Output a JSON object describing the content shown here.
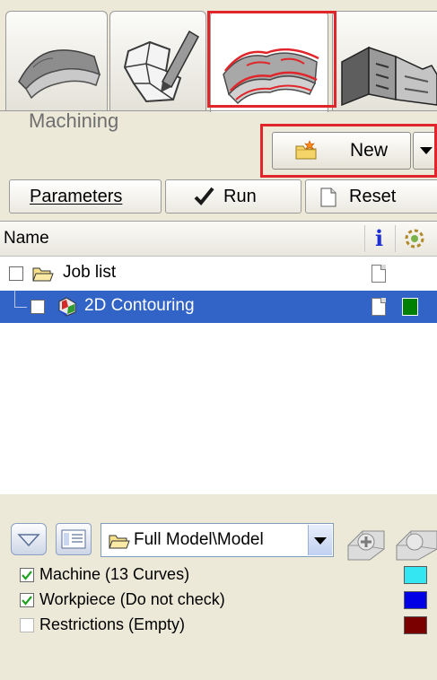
{
  "colors": {
    "selection": "#3164c6",
    "highlight_frame": "#e0262a",
    "machine_swatch": "#33e6f2",
    "workpiece_swatch": "#0000e6",
    "restrictions_swatch": "#7a0000",
    "status_green": "#008000"
  },
  "tabs": [
    {
      "icon": "roof-surface-icon",
      "active": false
    },
    {
      "icon": "sketch-pen-icon",
      "active": false
    },
    {
      "icon": "machining-surface-icon",
      "active": true
    },
    {
      "icon": "factory-icon",
      "active": false
    }
  ],
  "section": {
    "title": "Machining"
  },
  "new_button": {
    "label": "New",
    "icon": "new-folder-icon"
  },
  "actions": {
    "parameters_label": "Parameters",
    "run_label": "Run",
    "reset_label": "Reset"
  },
  "tree": {
    "header_name": "Name",
    "header_info_icon": "info-icon",
    "header_status_icon": "status-icon",
    "rows": [
      {
        "label": "Job list",
        "selected": false
      },
      {
        "label": "2D Contouring",
        "selected": true
      }
    ]
  },
  "bottom": {
    "path_value": "Full Model\\Model",
    "layers": [
      {
        "label": "Machine  (13 Curves)",
        "checked": true
      },
      {
        "label": "Workpiece  (Do not check)",
        "checked": true
      },
      {
        "label": "Restrictions  (Empty)",
        "checked": false
      }
    ]
  }
}
